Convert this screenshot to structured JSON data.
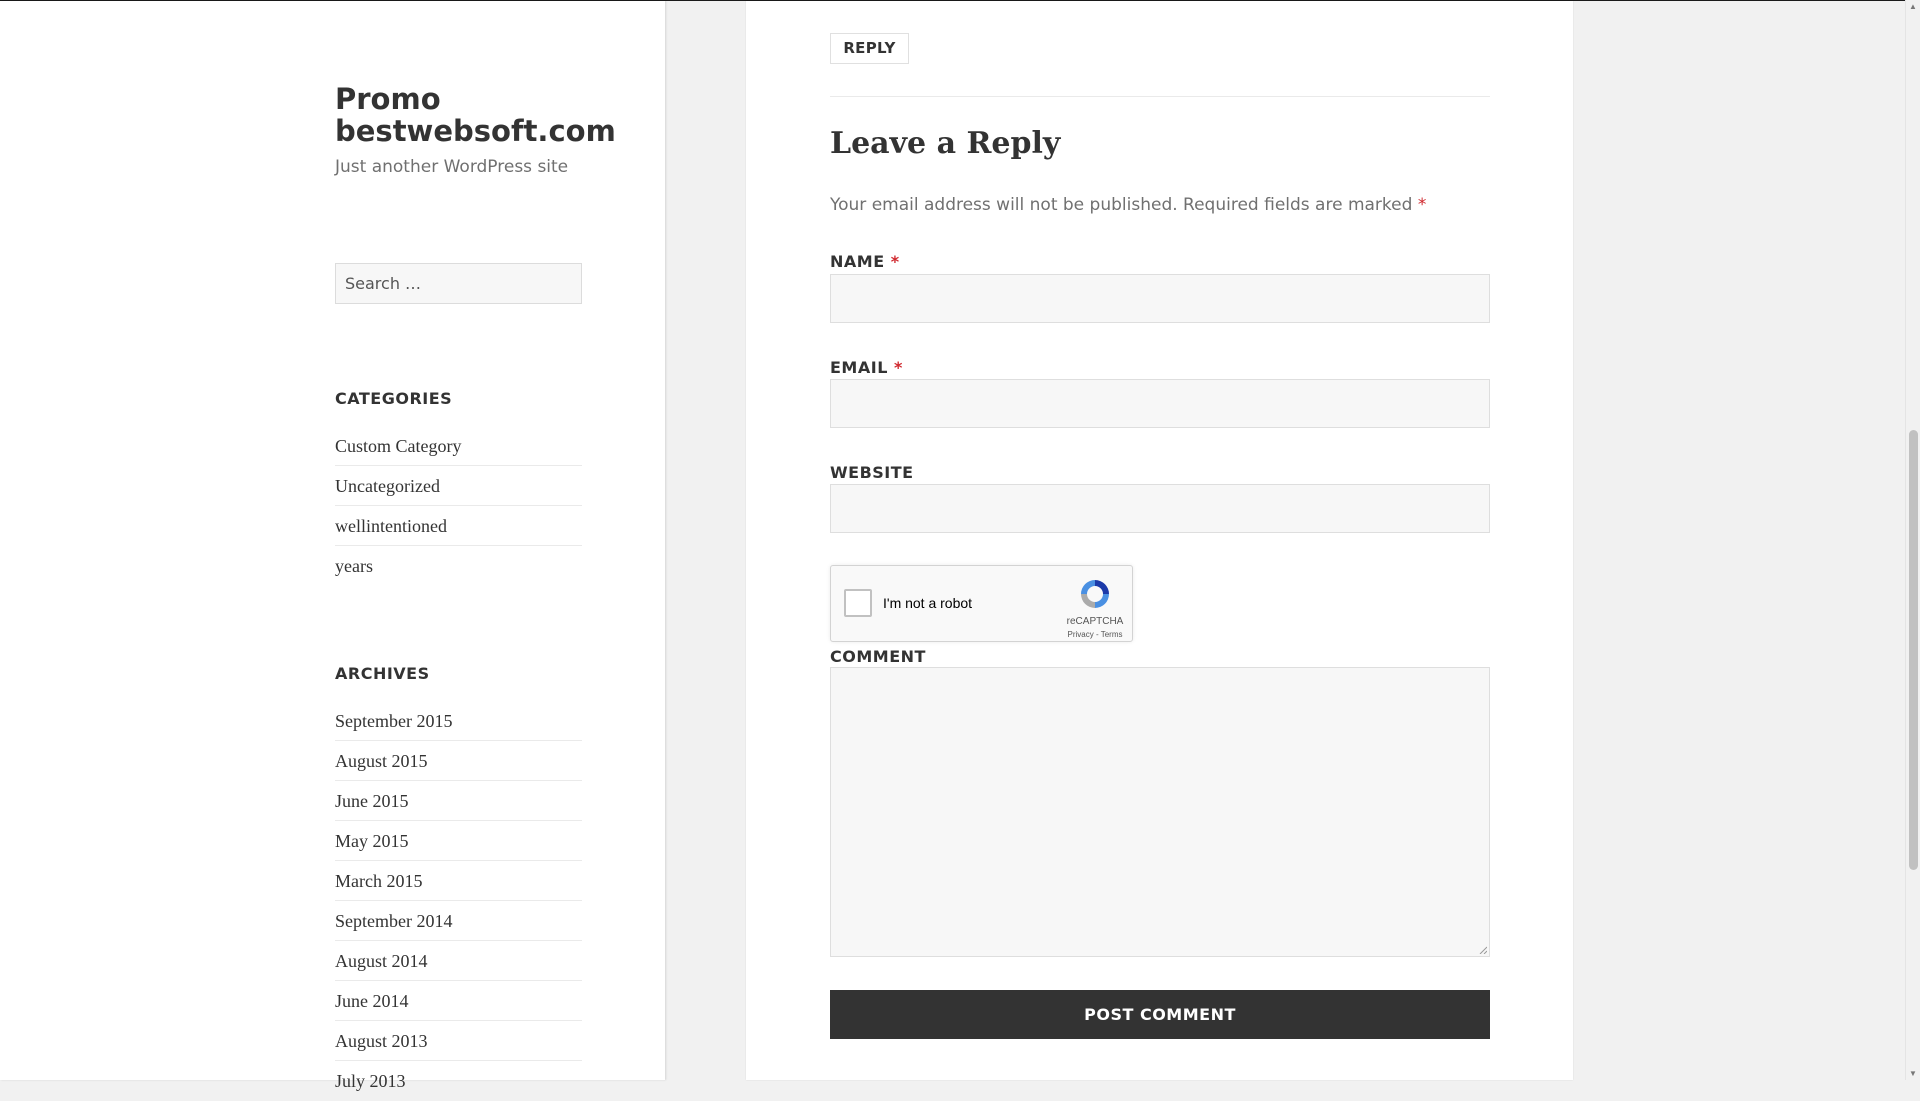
{
  "site": {
    "title": "Promo bestwebsoft.com",
    "description": "Just another WordPress site"
  },
  "search": {
    "placeholder": "Search …"
  },
  "categories": {
    "title": "CATEGORIES",
    "items": [
      "Custom Category",
      "Uncategorized",
      "wellintentioned",
      "years"
    ]
  },
  "archives": {
    "title": "ARCHIVES",
    "items": [
      "September 2015",
      "August 2015",
      "June 2015",
      "May 2015",
      "March 2015",
      "September 2014",
      "August 2014",
      "June 2014",
      "August 2013",
      "July 2013"
    ]
  },
  "comment_form": {
    "reply_button": "REPLY",
    "title": "Leave a Reply",
    "notes": "Your email address will not be published. Required fields are marked",
    "required_mark": "*",
    "name_label": "NAME",
    "email_label": "EMAIL",
    "website_label": "WEBSITE",
    "comment_label": "COMMENT",
    "submit_label": "POST COMMENT",
    "recaptcha": {
      "label": "I'm not a robot",
      "brand": "reCAPTCHA",
      "links": "Privacy - Terms"
    }
  },
  "colors": {
    "accent_required": "#d0282e",
    "button_bg": "#333333",
    "sidebar_bg": "#ffffff",
    "page_bg": "#f1f1f1"
  }
}
